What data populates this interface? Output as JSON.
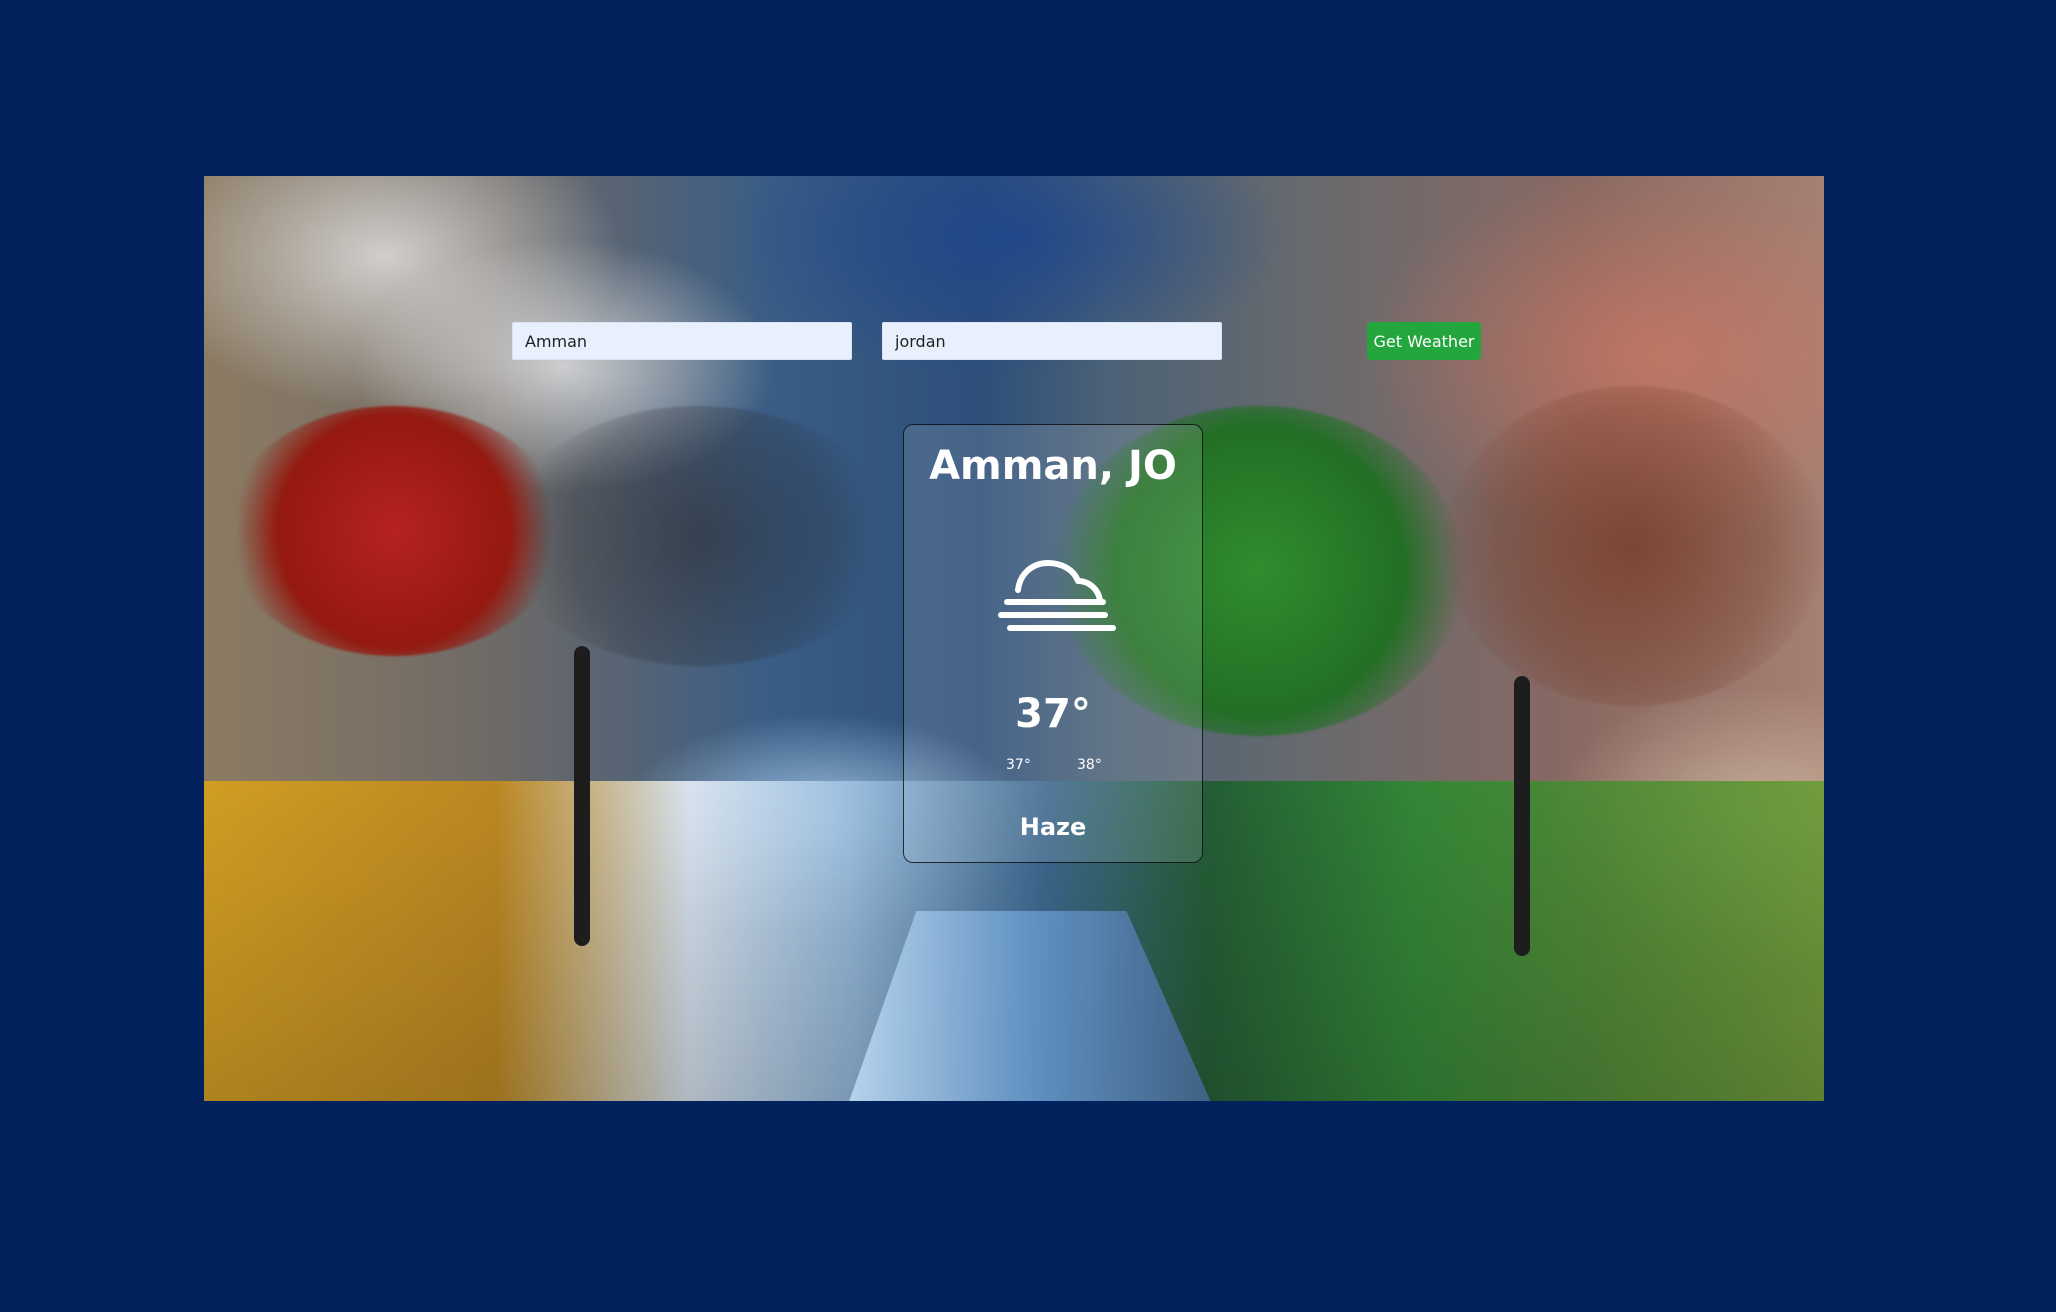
{
  "search": {
    "city_value": "Amman",
    "country_value": "jordan",
    "button_label": "Get Weather"
  },
  "weather": {
    "location": "Amman, JO",
    "temperature": "37°",
    "temp_min": "37°",
    "temp_max": "38°",
    "description": "Haze",
    "icon_name": "haze-icon"
  },
  "colors": {
    "page_background": "#01225c",
    "button_background": "#24a63f",
    "input_background": "#e8f0fe",
    "card_text": "#ffffff"
  }
}
